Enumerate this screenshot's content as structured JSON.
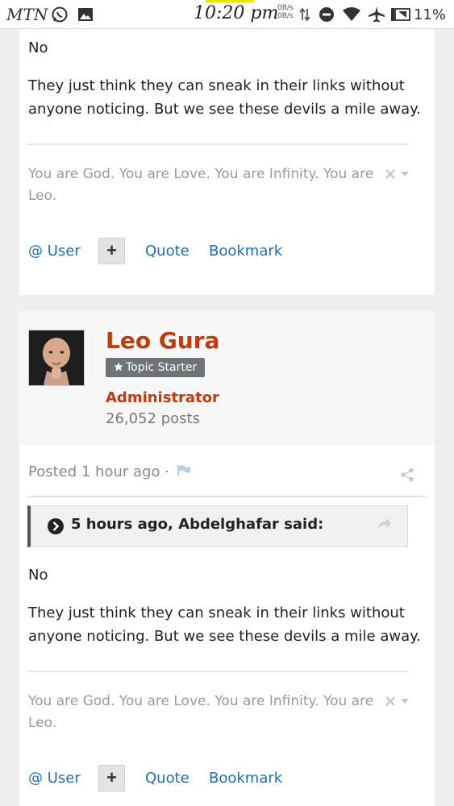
{
  "status_bar": {
    "carrier": "MTN",
    "time": "10:20 pm",
    "net_up": "0B/s",
    "net_down": "0B/s",
    "battery": "11%"
  },
  "post_top": {
    "quote_reply": "No",
    "body": [
      "They just think they can sneak in their links without",
      "anyone noticing. But we see these devils a mile away."
    ],
    "signature": [
      "You are God. You are Love. You are Infinity. You are",
      "Leo."
    ],
    "actions": {
      "user": "@ User",
      "plus": "+",
      "quote": "Quote",
      "bookmark": "Bookmark"
    }
  },
  "post_main": {
    "author": {
      "name": "Leo Gura",
      "badge": "Topic Starter",
      "role": "Administrator",
      "posts": "26,052 posts"
    },
    "posted": "Posted 1 hour ago ·",
    "quote_cite": "5 hours ago, Abdelghafar said:",
    "quote_reply": "No",
    "body": [
      "They just think they can sneak in their links without",
      "anyone noticing. But we see these devils a mile away."
    ],
    "signature": [
      "You are God. You are Love. You are Infinity. You are",
      "Leo."
    ],
    "actions": {
      "user": "@ User",
      "plus": "+",
      "quote": "Quote",
      "bookmark": "Bookmark"
    }
  },
  "colors": {
    "author_accent": "#c33a0b",
    "link": "#1f6fb5",
    "signature": "#9a9a9a",
    "badge_bg": "#6f7478"
  },
  "icons": [
    "whatsapp-icon",
    "gallery-icon",
    "data-arrows-icon",
    "dnd-icon",
    "wifi-icon",
    "airplane-icon",
    "screenshot-icon",
    "star-icon",
    "flag-icon",
    "share-icon",
    "chevron-right-circle-icon",
    "reply-arrow-icon",
    "close-icon",
    "caret-down-icon"
  ]
}
